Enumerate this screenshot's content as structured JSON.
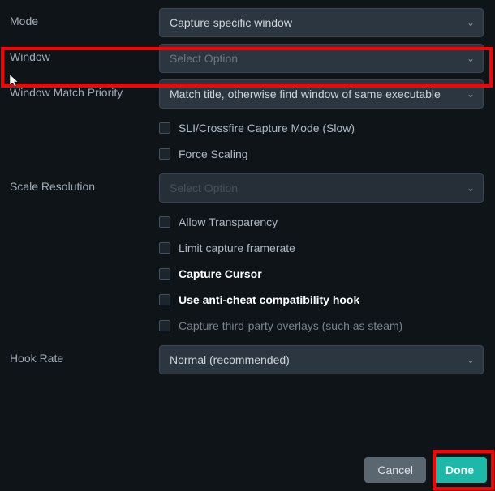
{
  "fields": {
    "mode": {
      "label": "Mode",
      "value": "Capture specific window"
    },
    "window": {
      "label": "Window",
      "placeholder": "Select Option"
    },
    "matchPriority": {
      "label": "Window Match Priority",
      "value": "Match title, otherwise find window of same executable"
    },
    "scaleRes": {
      "label": "Scale Resolution",
      "placeholder": "Select Option"
    },
    "hookRate": {
      "label": "Hook Rate",
      "value": "Normal (recommended)"
    }
  },
  "checkboxes": {
    "sliCrossfire": "SLI/Crossfire Capture Mode (Slow)",
    "forceScaling": "Force Scaling",
    "allowTransparency": "Allow Transparency",
    "limitFramerate": "Limit capture framerate",
    "captureCursor": "Capture Cursor",
    "antiCheat": "Use anti-cheat compatibility hook",
    "thirdParty": "Capture third-party overlays (such as steam)"
  },
  "buttons": {
    "cancel": "Cancel",
    "done": "Done"
  }
}
